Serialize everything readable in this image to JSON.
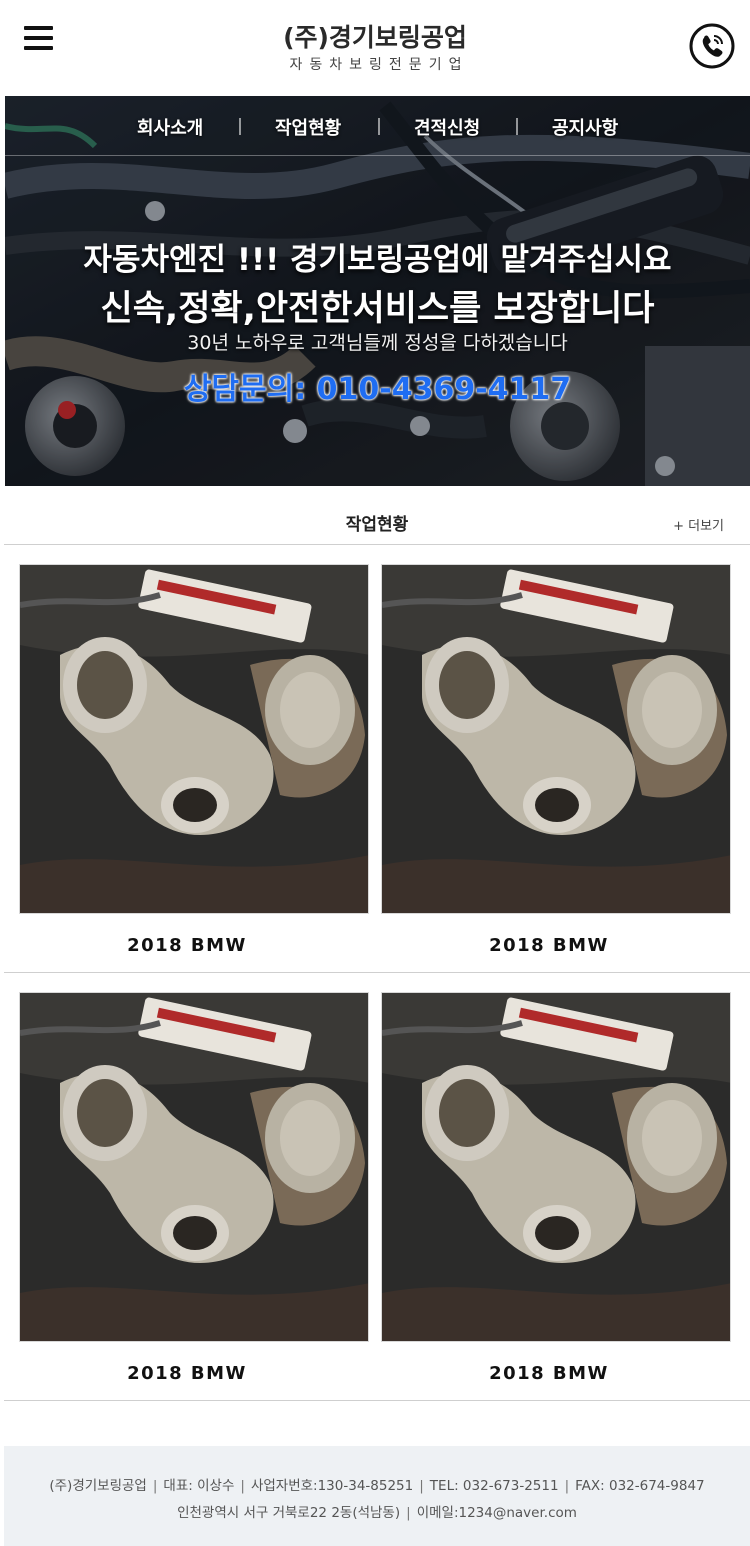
{
  "header": {
    "logo_main": "(주)경기보링공업",
    "logo_sub": "자동차보링전문기업",
    "menu_icon": "hamburger-menu-icon",
    "call_icon": "phone-call-icon"
  },
  "nav": {
    "items": [
      "회사소개",
      "작업현황",
      "견적신청",
      "공지사항"
    ]
  },
  "hero": {
    "title1": "자동차엔진 !!! 경기보링공업에 맡겨주십시요",
    "title2": "신속,정확,안전한서비스를 보장합니다",
    "desc": "30년 노하우로 고객님들께 정성을 다하겠습니다",
    "contact": "상담문의: 010-4369-4117",
    "contact_color": "#1f6df2"
  },
  "section": {
    "title": "작업현황",
    "more": "+ 더보기"
  },
  "gallery": {
    "items": [
      {
        "caption": "2018 BMW"
      },
      {
        "caption": "2018 BMW"
      },
      {
        "caption": "2018 BMW"
      },
      {
        "caption": "2018 BMW"
      }
    ]
  },
  "footer": {
    "company": "(주)경기보링공업",
    "ceo": "대표: 이상수",
    "biz_no": "사업자번호:130-34-85251",
    "tel": "TEL: 032-673-2511",
    "fax": "FAX: 032-674-9847",
    "address": "인천광역시 서구 거북로22 2동(석남동)",
    "email": "이메일:1234@naver.com",
    "background": "#eef1f4"
  }
}
